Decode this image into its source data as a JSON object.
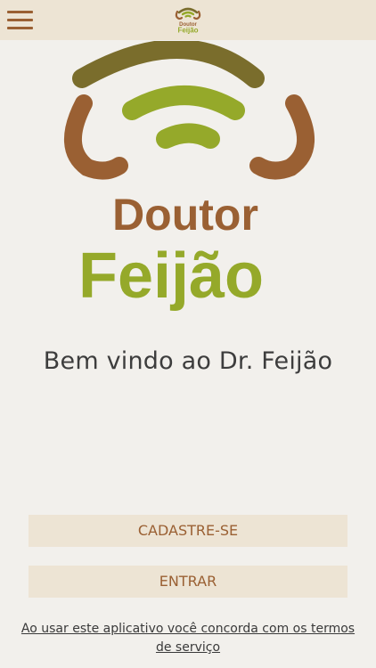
{
  "header": {
    "menu_icon": "hamburger-menu-icon",
    "logo_top": "Doutor",
    "logo_bottom": "Feijão"
  },
  "brand": {
    "name_top": "Doutor",
    "name_bottom": "Feijão",
    "colors": {
      "brown": "#9a6033",
      "dark_olive": "#7a6d2c",
      "green": "#95a92a",
      "bar_bg": "#ede4d4",
      "page_bg": "#f2f0ec"
    }
  },
  "welcome_text": "Bem vindo ao Dr. Feijão",
  "buttons": {
    "signup": "CADASTRE-SE",
    "login": "ENTRAR"
  },
  "terms_text": "Ao usar este aplicativo você concorda com os termos de serviço"
}
